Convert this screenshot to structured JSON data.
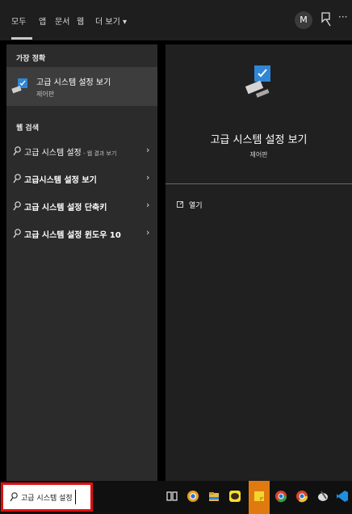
{
  "tabs": [
    {
      "label": "모두"
    },
    {
      "label": "앱"
    },
    {
      "label": "문서"
    },
    {
      "label": "웹"
    },
    {
      "label": "더 보기 ▾"
    }
  ],
  "header": {
    "avatar_letter": "M",
    "more_label": "···"
  },
  "best_match": {
    "section_label": "가장 정확",
    "title": "고급 시스템 설정 보기",
    "subtitle": "제어판"
  },
  "web_search": {
    "section_label": "웹 검색",
    "items": [
      {
        "label": "고급 시스템 설정",
        "suffix": " - 웹 결과 보기"
      },
      {
        "label": "고급시스템 설정 보기",
        "suffix": ""
      },
      {
        "label": "고급 시스템 설정 단축키",
        "suffix": ""
      },
      {
        "label": "고급 시스템 설정 윈도우 10",
        "suffix": ""
      }
    ],
    "chevron": "›"
  },
  "preview": {
    "title": "고급 시스템 설정 보기",
    "subtitle": "제어판",
    "open_label": "열기"
  },
  "search": {
    "value": "고급 시스템 설정"
  },
  "colors": {
    "accent_red": "#e01010",
    "panel_left": "#2b2b2b",
    "panel_right": "#202020",
    "highlight": "#3d3d3d"
  },
  "taskbar_icons": [
    "task-view-icon",
    "chrome-icon",
    "file-explorer-icon",
    "kakaotalk-icon",
    "sticky-notes-icon",
    "chrome-profile-icon",
    "chrome-profile2-icon",
    "paint-icon",
    "vscode-icon"
  ]
}
